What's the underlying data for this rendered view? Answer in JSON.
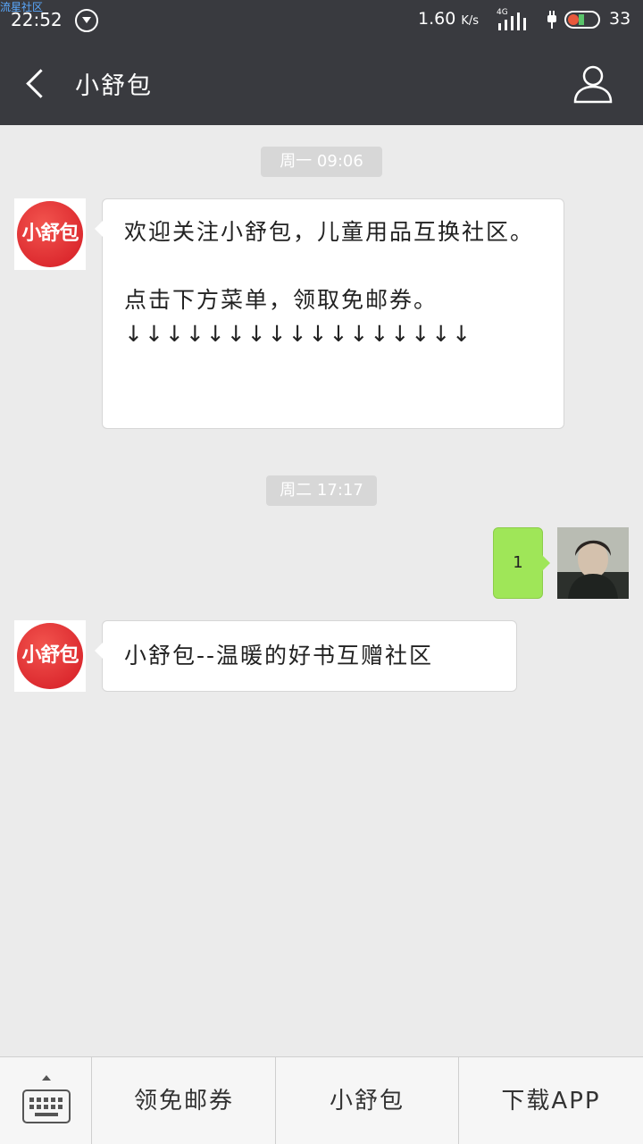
{
  "status_bar": {
    "watermark": "流星社区",
    "time": "22:52",
    "net_speed": "1.60",
    "net_unit": "K/s",
    "network_type": "4G",
    "battery": "33"
  },
  "header": {
    "title": "小舒包",
    "back_icon": "chevron-left-icon",
    "profile_icon": "person-icon"
  },
  "chat": {
    "bot_avatar_text": "小舒包",
    "messages": [
      {
        "kind": "time",
        "text": "周一 09:06"
      },
      {
        "kind": "incoming",
        "text": "欢迎关注小舒包，儿童用品互换社区。\n\n点击下方菜单，领取免邮券。\n↓↓↓↓↓↓↓↓↓↓↓↓↓↓↓↓↓"
      },
      {
        "kind": "time",
        "text": "周二 17:17"
      },
      {
        "kind": "outgoing",
        "text": "1"
      },
      {
        "kind": "incoming",
        "text": "小舒包--温暖的好书互赠社区"
      }
    ]
  },
  "menu": {
    "keyboard_icon": "keyboard-icon",
    "items": [
      "领免邮券",
      "小舒包",
      "下载APP"
    ]
  },
  "colors": {
    "header_bg": "#393a3f",
    "chat_bg": "#ebebeb",
    "outgoing_bubble": "#9fe658",
    "brand_red": "#e2232c"
  }
}
